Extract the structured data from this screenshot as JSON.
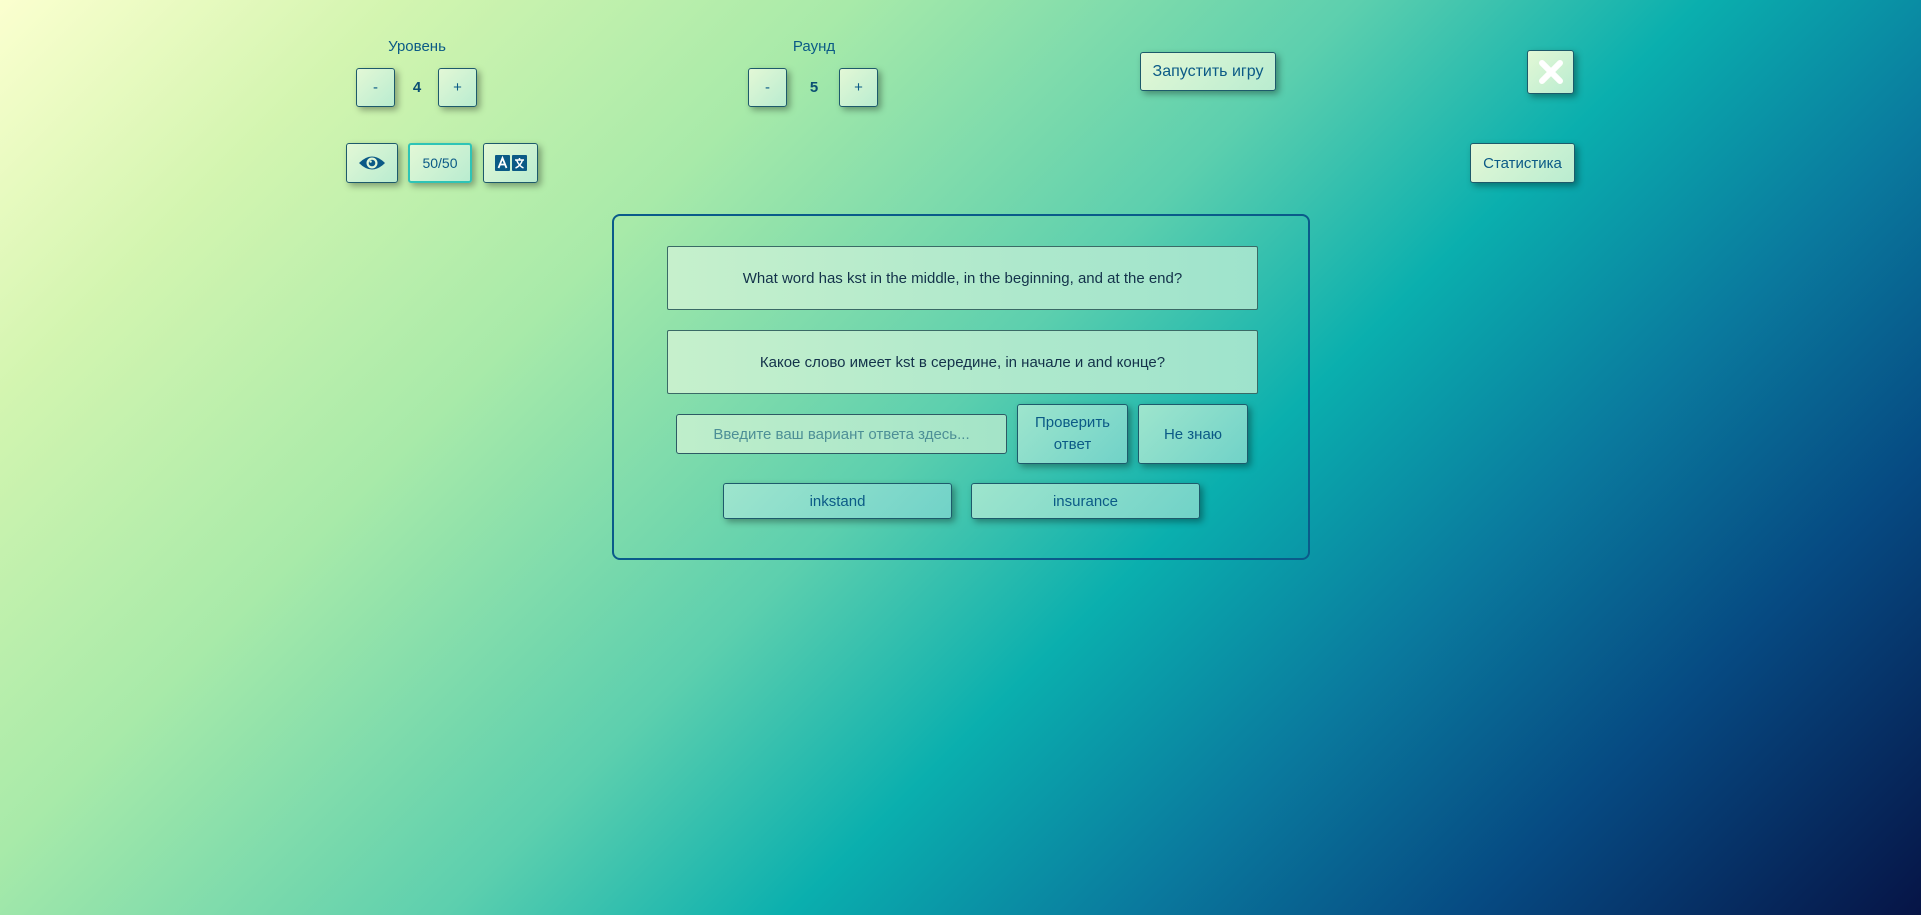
{
  "level": {
    "label": "Уровень",
    "value": "4",
    "minus": "-",
    "plus": "+"
  },
  "round": {
    "label": "Раунд",
    "value": "5",
    "minus": "-",
    "plus": "+"
  },
  "toolbar": {
    "start_game": "Запустить игру",
    "close_icon": "close-icon",
    "eye_icon": "eye-icon",
    "fifty_fifty": "50/50",
    "translate_icon": "translate-icon",
    "stats": "Статистика"
  },
  "question": {
    "english": "What word has kst in the middle, in the beginning, and at the end?",
    "russian": "Какое слово имеет kst в середине, in начале и and конце?"
  },
  "answer": {
    "placeholder": "Введите ваш вариант ответа здесь...",
    "check_line1": "Проверить",
    "check_line2": "ответ",
    "dont_know": "Не знаю"
  },
  "options": [
    "inkstand",
    "insurance"
  ],
  "colors": {
    "accent": "#0b5a86",
    "panel_border": "#0a5b8a"
  }
}
